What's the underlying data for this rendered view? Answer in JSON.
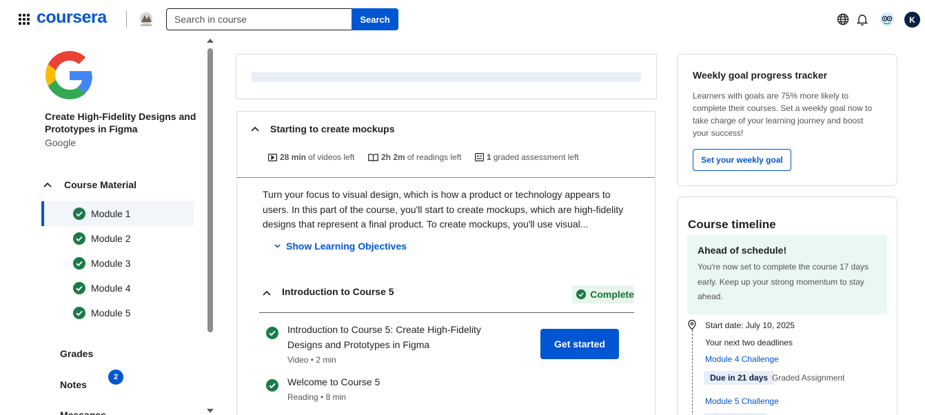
{
  "header": {
    "logo_text": "coursera",
    "search_placeholder": "Search in course",
    "search_button": "Search",
    "avatar_initial": "K"
  },
  "sidebar": {
    "course_title": "Create High-Fidelity Designs and Prototypes in Figma",
    "partner": "Google",
    "course_material_label": "Course Material",
    "modules": [
      {
        "label": "Module 1",
        "status": "complete",
        "active": true
      },
      {
        "label": "Module 2",
        "status": "complete",
        "active": false
      },
      {
        "label": "Module 3",
        "status": "complete",
        "active": false
      },
      {
        "label": "Module 4",
        "status": "complete",
        "active": false
      },
      {
        "label": "Module 5",
        "status": "complete",
        "active": false
      }
    ],
    "links": {
      "grades": "Grades",
      "notes": "Notes",
      "messages": "Messages",
      "messages_count": "2"
    }
  },
  "main": {
    "module_title": "Starting to create mockups",
    "videos_time": "28 min",
    "videos_suffix": "of videos left",
    "readings_time": "2h 2m",
    "readings_suffix": "of readings left",
    "graded_count": "1",
    "graded_suffix": "graded assessment left",
    "description": "Turn your focus to visual design, which is how a product or technology appears to users. In this part of the course, you'll start to create mockups, which are high-fidelity designs that represent a final product. To create mockups, you'll use visual...",
    "objectives_link": "Show Learning Objectives",
    "lesson_title": "Introduction to Course 5",
    "lesson_status": "Complete",
    "items": [
      {
        "title": "Introduction to Course 5: Create High-Fidelity Designs and Prototypes in Figma",
        "meta": "Video • 2 min"
      },
      {
        "title": "Welcome to Course 5",
        "meta": "Reading • 8 min"
      }
    ],
    "get_started": "Get started"
  },
  "goal": {
    "title": "Weekly goal progress tracker",
    "text": "Learners with goals are 75% more likely to complete their courses. Set a weekly goal now to take charge of your learning journey and boost your success!",
    "button": "Set your weekly goal"
  },
  "timeline": {
    "title": "Course timeline",
    "ahead_title": "Ahead of schedule!",
    "ahead_text": "You're now set to complete the course 17 days early. Keep up your strong momentum to stay ahead.",
    "start_date": "Start date: July 10, 2025",
    "next_deadlines": "Your next two deadlines",
    "deadline1_link": "Module 4 Challenge",
    "deadline1_due": "Due in 21 days",
    "deadline1_type": "Graded Assignment",
    "deadline2_link": "Module 5 Challenge"
  },
  "colors": {
    "brand_blue": "#0056d2",
    "complete_green": "#137333",
    "check_green": "#1c7a4a"
  }
}
